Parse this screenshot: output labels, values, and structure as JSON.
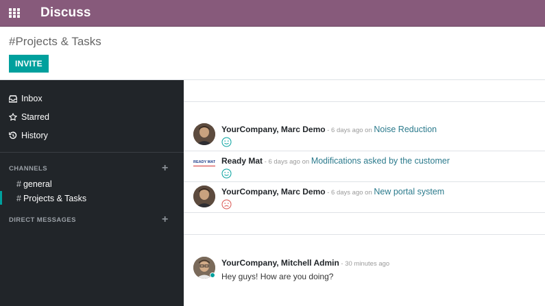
{
  "header": {
    "app_title": "Discuss",
    "apps_icon": "apps-grid-icon"
  },
  "control_panel": {
    "channel_title": "#Projects & Tasks",
    "invite_label": "INVITE"
  },
  "sidebar": {
    "nav": [
      {
        "label": "Inbox",
        "icon": "inbox-icon"
      },
      {
        "label": "Starred",
        "icon": "star-icon"
      },
      {
        "label": "History",
        "icon": "history-icon"
      }
    ],
    "channels_title": "CHANNELS",
    "channels": [
      {
        "hash": "#",
        "label": "general"
      },
      {
        "hash": "#",
        "label": "Projects & Tasks",
        "active": true
      }
    ],
    "direct_messages_title": "DIRECT MESSAGES"
  },
  "messages": [
    {
      "author": "YourCompany, Marc Demo",
      "meta": " - 6 days ago on ",
      "record": "Noise Reduction",
      "mood": "happy"
    },
    {
      "author": "Ready Mat",
      "meta": " - 6 days ago on ",
      "record": "Modifications asked by the customer",
      "mood": "happy",
      "logo_text": "READY MAT"
    },
    {
      "author": "YourCompany, Marc Demo",
      "meta": " - 6 days ago on ",
      "record": "New portal system",
      "mood": "unhappy"
    },
    {
      "author": "YourCompany, Mitchell Admin",
      "meta": " - 30 minutes ago",
      "body": "Hey guys! How are you doing?"
    }
  ],
  "colors": {
    "brand": "#875a7b",
    "accent": "#00a09d",
    "sidebar_bg": "#212529",
    "link": "#2b7a8c",
    "happy": "#00a09d",
    "unhappy": "#d9534f"
  }
}
